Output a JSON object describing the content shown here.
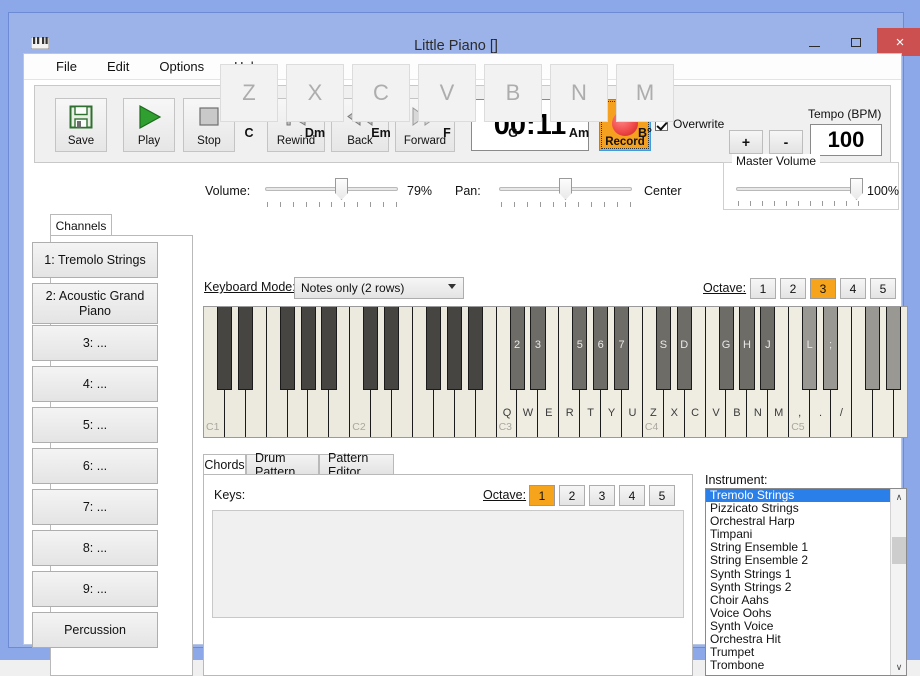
{
  "window": {
    "title": "Little Piano []",
    "icon": "piano-icon",
    "minimize": "–",
    "maximize": "□",
    "close": "×",
    "close_color": "#cd5050",
    "titlebar_color": "#9cb3ea"
  },
  "menu": {
    "items": [
      "File",
      "Edit",
      "Options",
      "Help"
    ]
  },
  "toolbar": {
    "buttons": [
      {
        "name": "save",
        "label": "Save",
        "icon": "floppy-disk-icon"
      },
      {
        "name": "play",
        "label": "Play",
        "icon": "play-triangle-icon"
      },
      {
        "name": "stop",
        "label": "Stop",
        "icon": "stop-square-icon"
      },
      {
        "name": "rewind",
        "label": "Rewind",
        "icon": "rewind-to-start-icon"
      },
      {
        "name": "back",
        "label": "Back",
        "icon": "double-left-icon"
      },
      {
        "name": "forward",
        "label": "Forward",
        "icon": "double-right-icon"
      }
    ],
    "timer": "00:11",
    "record_label": "Record",
    "record_color": "#f5a01e",
    "overwrite_label": "Overwrite",
    "overwrite_checked": true,
    "tempo_label": "Tempo (BPM)",
    "tempo_plus": "+",
    "tempo_minus": "-",
    "tempo_value": "100"
  },
  "mixer": {
    "volume_label": "Volume:",
    "volume_value": "79%",
    "volume_percent": 79,
    "pan_label": "Pan:",
    "pan_value": "Center",
    "pan_percent": 50,
    "master_label": "Master Volume",
    "master_value": "100%",
    "master_percent": 100
  },
  "channels": {
    "tab_label": "Channels",
    "items": [
      "1: Tremolo Strings",
      "2: Acoustic Grand Piano",
      "3: ...",
      "4: ...",
      "5: ...",
      "6: ...",
      "7: ...",
      "8: ...",
      "9: ...",
      "Percussion"
    ],
    "selected_index": 0
  },
  "keyboard": {
    "mode_label": "Keyboard Mode:",
    "mode_value": "Notes only (2 rows)",
    "mode_options": [
      "Notes only (2 rows)"
    ],
    "octave_label": "Octave:",
    "octave_buttons": [
      "1",
      "2",
      "3",
      "4",
      "5"
    ],
    "octave_selected": "3",
    "octave_marks": [
      "C1",
      "C2",
      "C3",
      "C4",
      "C5"
    ],
    "white_key_labels": [
      "",
      "",
      "",
      "",
      "",
      "",
      "",
      "",
      "",
      "",
      "",
      "",
      "",
      "",
      "Q",
      "W",
      "E",
      "R",
      "T",
      "Y",
      "U",
      "Z",
      "X",
      "C",
      "V",
      "B",
      "N",
      "M",
      ",",
      ".",
      "/",
      "",
      "",
      "",
      ""
    ],
    "black_key_labels": [
      "",
      "",
      "",
      "",
      "",
      "",
      "",
      "",
      "",
      "",
      "2",
      "3",
      "5",
      "6",
      "7",
      "S",
      "D",
      "G",
      "H",
      "J",
      "L",
      ";",
      "",
      "",
      ""
    ]
  },
  "bottom_tabs": {
    "items": [
      "Chords",
      "Drum Pattern",
      "Pattern Editor"
    ],
    "selected": "Chords"
  },
  "chords": {
    "keys_label": "Keys:",
    "octave_label": "Octave:",
    "octave_buttons": [
      "1",
      "2",
      "3",
      "4",
      "5"
    ],
    "octave_selected": "1",
    "cells": [
      {
        "key": "Z",
        "name": "C"
      },
      {
        "key": "X",
        "name": "Dm"
      },
      {
        "key": "C",
        "name": "Em"
      },
      {
        "key": "V",
        "name": "F"
      },
      {
        "key": "B",
        "name": "G"
      },
      {
        "key": "N",
        "name": "Am"
      },
      {
        "key": "M",
        "name": "B°"
      }
    ]
  },
  "instrument": {
    "label": "Instrument:",
    "selected": "Tremolo Strings",
    "items": [
      "Tremolo Strings",
      "Pizzicato Strings",
      "Orchestral Harp",
      "Timpani",
      "String Ensemble 1",
      "String Ensemble 2",
      "Synth Strings 1",
      "Synth Strings 2",
      "Choir Aahs",
      "Voice Oohs",
      "Synth Voice",
      "Orchestra Hit",
      "Trumpet",
      "Trombone"
    ],
    "scroll_up": "∧",
    "scroll_down": "∨"
  }
}
